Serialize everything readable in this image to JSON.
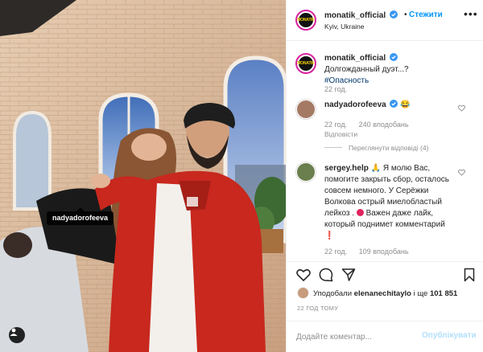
{
  "photo": {
    "tag_username": "nadyadorofeeva",
    "user_tag_icon": "person-icon"
  },
  "header": {
    "username": "monatik_official",
    "dot": "•",
    "follow_label": "Стежити",
    "location": "Kyiv, Ukraine",
    "more_icon": "ellipsis-icon",
    "avatar_text": "MONATIK"
  },
  "caption": {
    "username": "monatik_official",
    "text": "Долгожданный дуэт...?",
    "hashtag": "#Опасность",
    "time": "22 год."
  },
  "comments": [
    {
      "username": "nadyadorofeeva",
      "emoji": "😂",
      "time": "22 год.",
      "likes": "240 вподобань",
      "reply_label": "Відповісти",
      "view_replies": "Переглянути відповіді (4)"
    },
    {
      "username": "sergey.help",
      "text_before": "🙏 Я молю Вас, помогите закрыть сбор, осталось совсем немного. У Серёжки Волкова острый миелобластый лейкоз .",
      "text_after": "Важен даже лайк, который поднимет комментарий",
      "excl": "❗",
      "time": "22 год.",
      "likes": "109 вподобань"
    }
  ],
  "likes": {
    "prefix": "Уподобали",
    "user": "elenanechitaylo",
    "middle": "і ще",
    "count": "101 851"
  },
  "time_ago": "22 ГОД ТОМУ",
  "add_comment": {
    "placeholder": "Додайте коментар...",
    "post_label": "Опублікувати"
  },
  "colors": {
    "accent": "#0095f6",
    "verified": "#3897f0",
    "post_disabled": "#b2dffc",
    "jacket": "#c8281e"
  }
}
